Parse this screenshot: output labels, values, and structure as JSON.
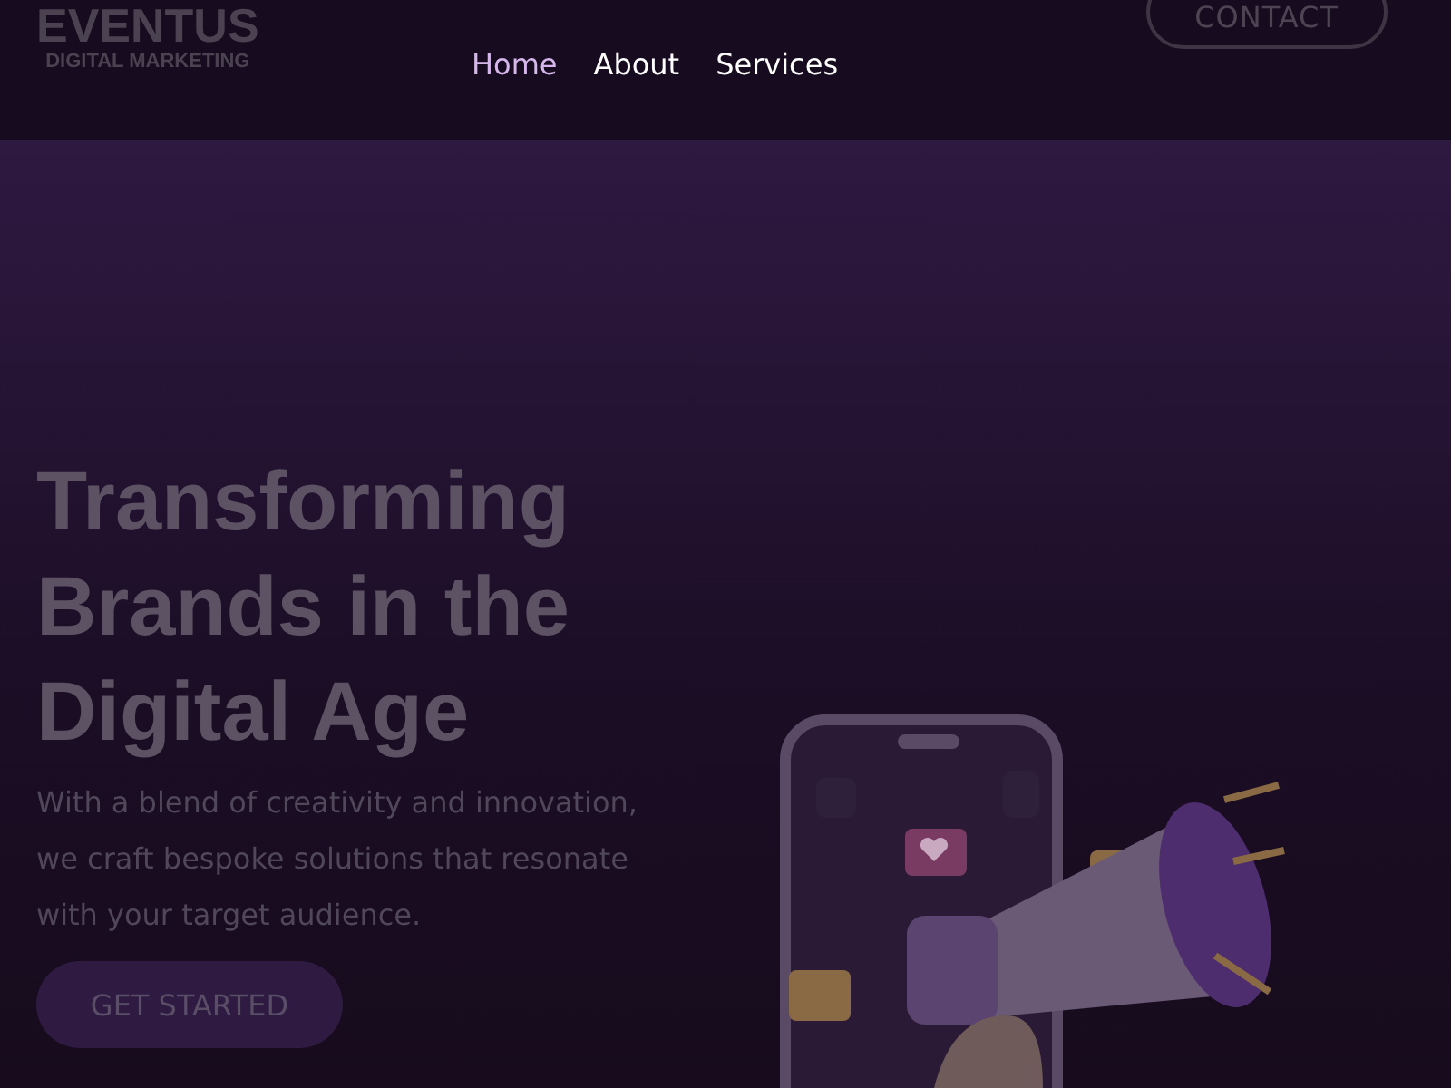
{
  "header": {
    "logo": {
      "name": "EVENTUS",
      "tagline": "DIGITAL MARKETING"
    },
    "nav": [
      {
        "label": "Home",
        "selected": true
      },
      {
        "label": "About",
        "selected": false
      },
      {
        "label": "Services",
        "selected": false
      }
    ],
    "contact_button": "CONTACT"
  },
  "hero": {
    "title": "Transforming Brands in the Digital Age",
    "text": "With a blend of creativity and innovation, we craft bespoke solutions that resonate with your target audience.",
    "button": "GET STARTED"
  }
}
